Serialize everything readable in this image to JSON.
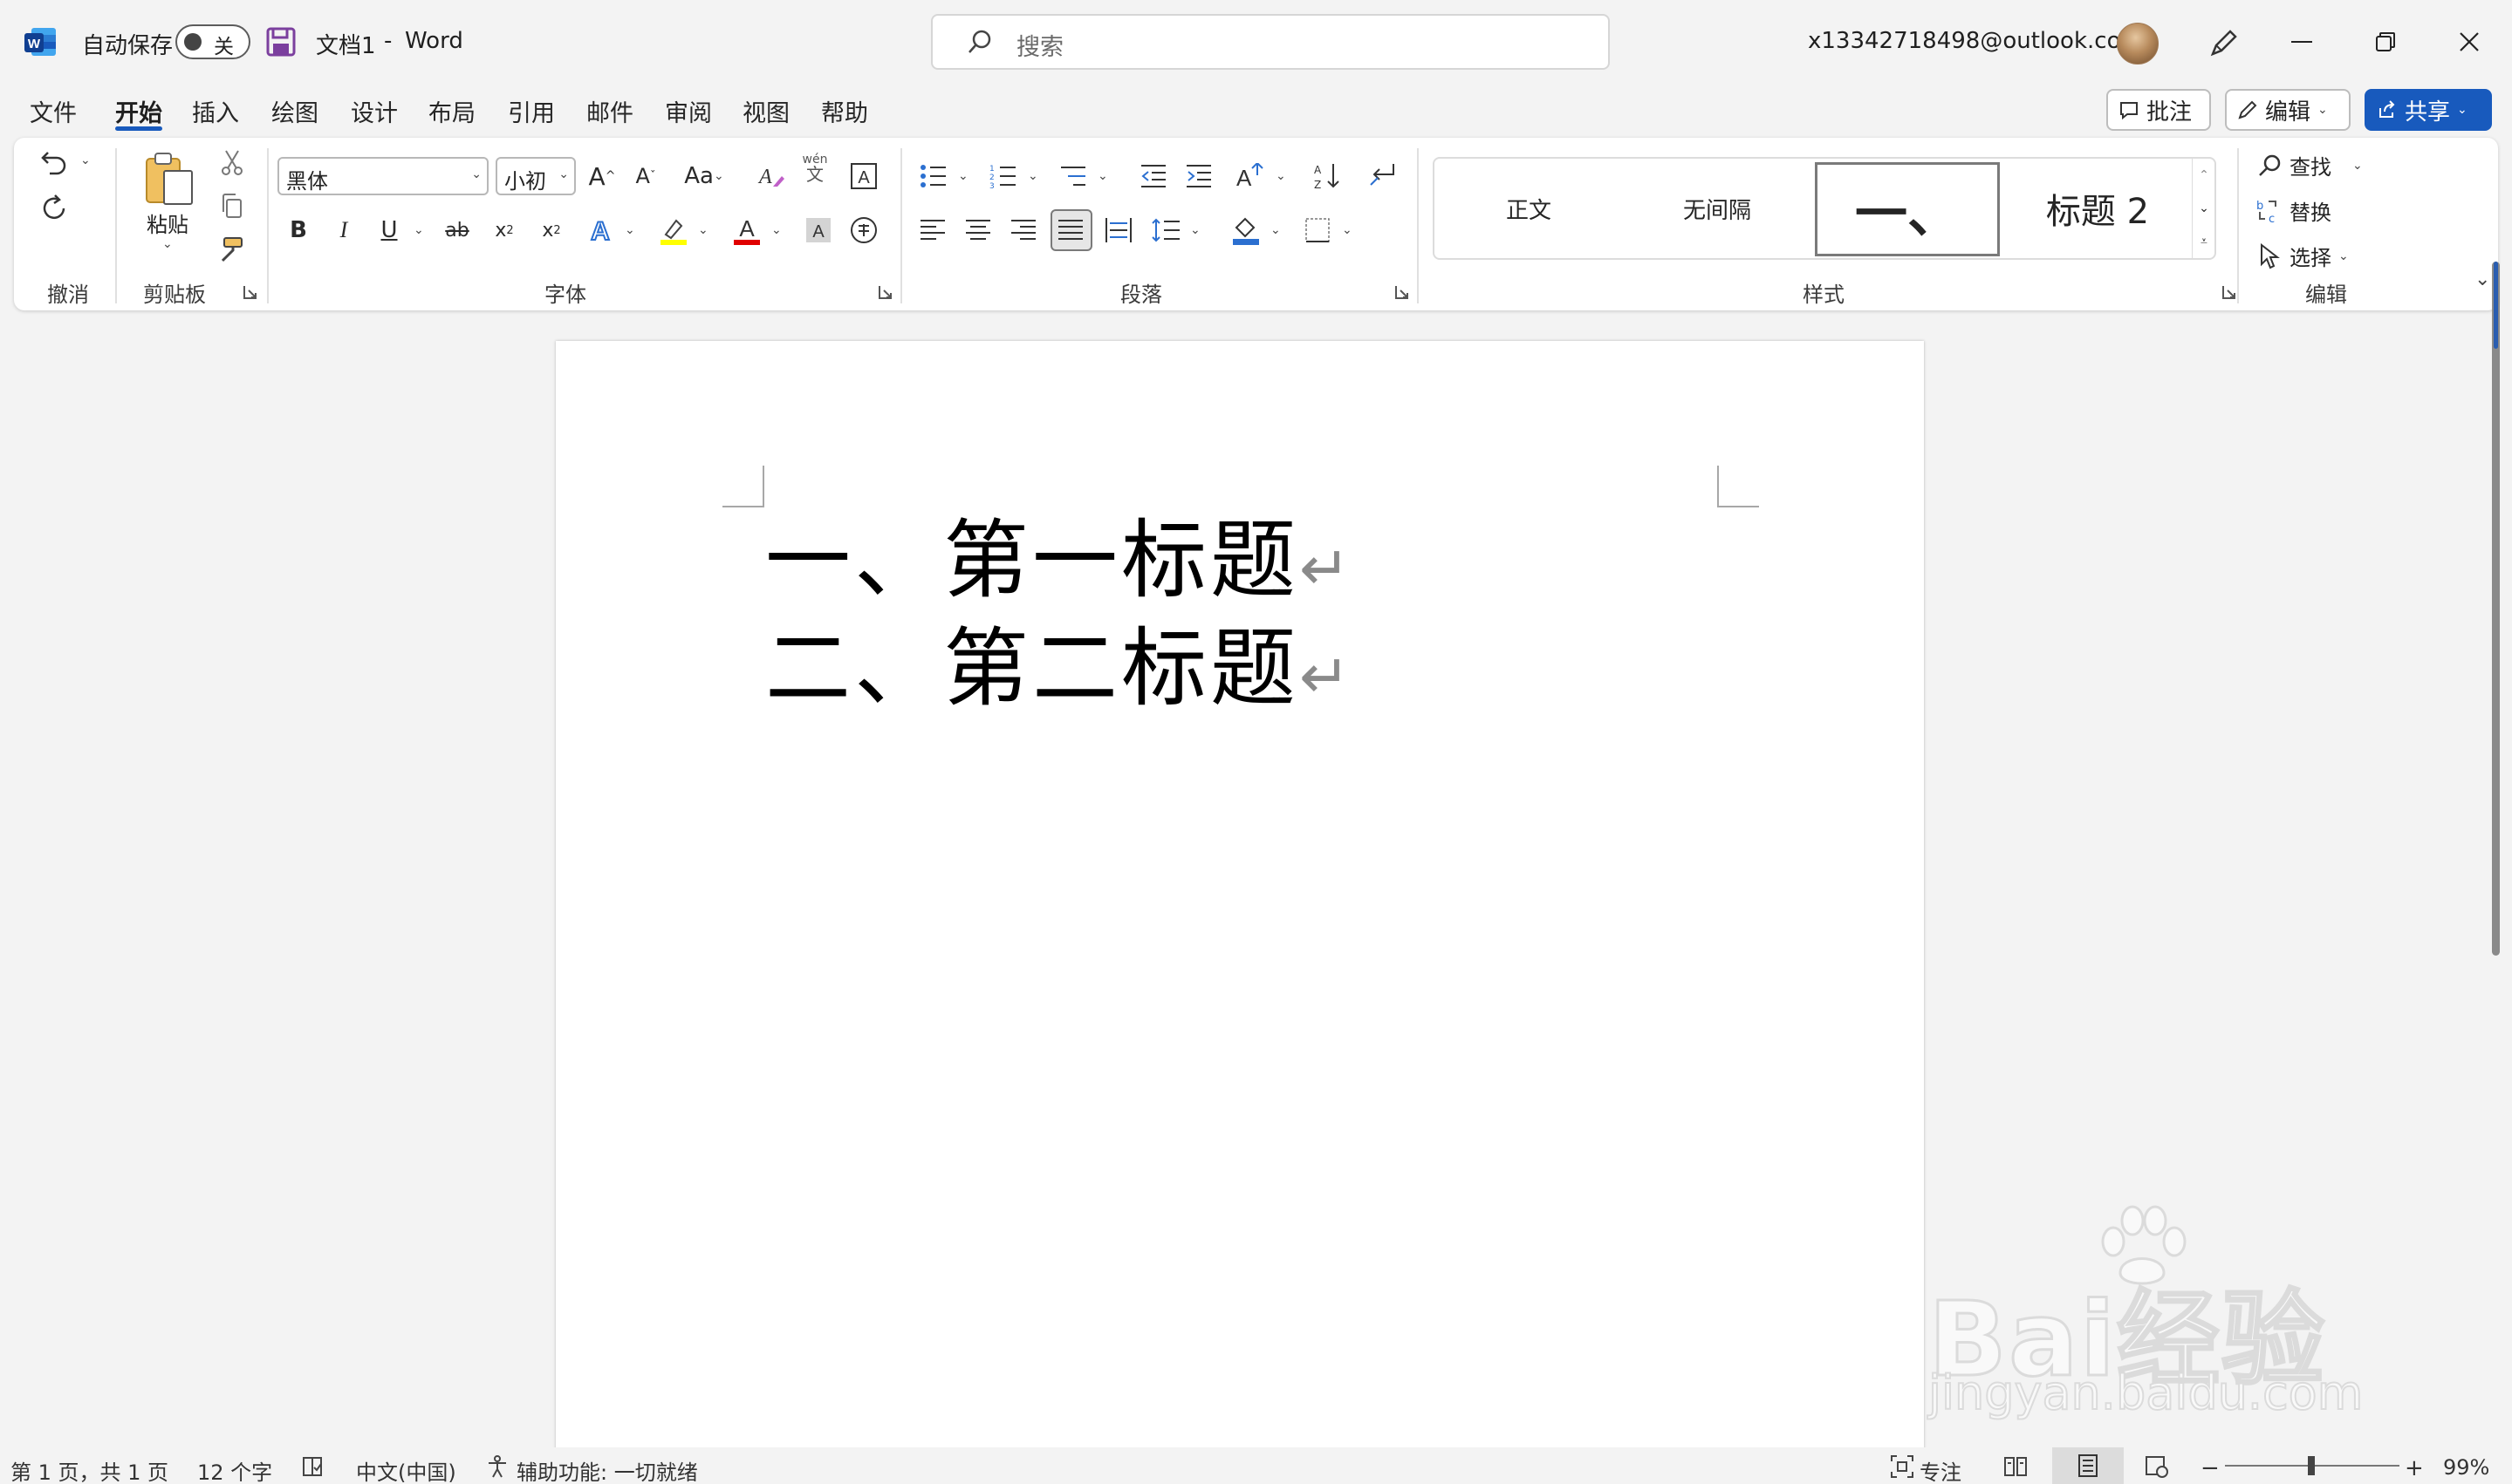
{
  "titlebar": {
    "autosave_label": "自动保存",
    "autosave_state": "关",
    "doc_title": "文档1",
    "separator": "-",
    "app_name": "Word",
    "search_placeholder": "搜索",
    "account": "x13342718498@outlook.com"
  },
  "tabs": [
    "文件",
    "开始",
    "插入",
    "绘图",
    "设计",
    "布局",
    "引用",
    "邮件",
    "审阅",
    "视图",
    "帮助"
  ],
  "active_tab": "开始",
  "right_buttons": {
    "comments": "批注",
    "editing": "编辑",
    "share": "共享"
  },
  "ribbon": {
    "undo_group": "撤消",
    "clipboard": {
      "label": "剪贴板",
      "paste": "粘贴"
    },
    "font": {
      "label": "字体",
      "name": "黑体",
      "size": "小初",
      "phonetic_top": "wén",
      "phonetic_bottom": "文"
    },
    "paragraph": {
      "label": "段落"
    },
    "styles": {
      "label": "样式",
      "items": [
        "正文",
        "无间隔",
        "一、",
        "标题 2"
      ]
    },
    "editing": {
      "label": "编辑",
      "find": "查找",
      "replace": "替换",
      "select": "选择"
    }
  },
  "document": {
    "lines": [
      "一、第一标题",
      "二、第二标题"
    ],
    "mark": "↵"
  },
  "statusbar": {
    "page": "第 1 页，共 1 页",
    "words": "12 个字",
    "language": "中文(中国)",
    "accessibility": "辅助功能: 一切就绪",
    "focus": "专注",
    "zoom": "99%",
    "zoom_minus": "−",
    "zoom_plus": "+",
    "zoom_level": 0.99
  },
  "watermark": {
    "brand": "Bai经验",
    "url": "jingyan.baidu.com"
  },
  "colors": {
    "accent": "#185abd",
    "highlight": "#ffff00",
    "font_color": "#e00000"
  }
}
